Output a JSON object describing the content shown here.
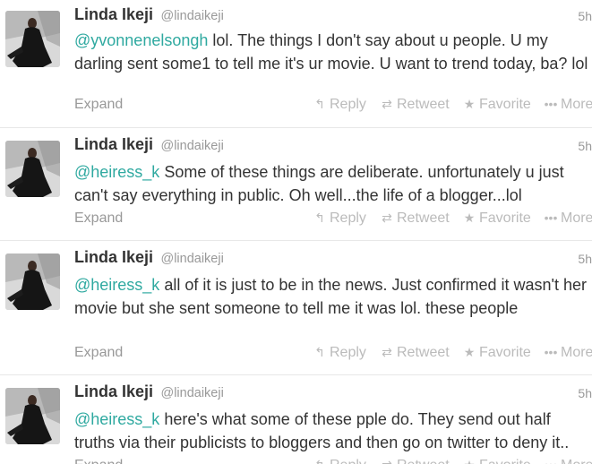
{
  "actions": {
    "expand": "Expand",
    "reply": "Reply",
    "retweet": "Retweet",
    "favorite": "Favorite",
    "more": "More"
  },
  "icons": {
    "reply": "reply-arrow-icon",
    "retweet": "retweet-icon",
    "favorite": "star-icon",
    "more": "ellipsis-icon"
  },
  "colors": {
    "mention": "#2fa9a0",
    "text": "#333333",
    "muted": "#999999"
  },
  "tweets": [
    {
      "fullname": "Linda Ikeji",
      "username": "@lindaikeji",
      "time": "5h",
      "mention": "@yvonnenelsongh",
      "body": " lol. The things I don't say about u people. U my darling sent some1 to tell me it's ur movie. U want to trend today, ba? lol"
    },
    {
      "fullname": "Linda Ikeji",
      "username": "@lindaikeji",
      "time": "5h",
      "mention": "@heiress_k",
      "body": " Some of these things are deliberate. unfortunately u just can't say everything in public. Oh well...the life of a blogger...lol"
    },
    {
      "fullname": "Linda Ikeji",
      "username": "@lindaikeji",
      "time": "5h",
      "mention": "@heiress_k",
      "body": " all of it is just to be in the news. Just confirmed it wasn't her movie but she sent someone to tell me it was lol. these people"
    },
    {
      "fullname": "Linda Ikeji",
      "username": "@lindaikeji",
      "time": "5h",
      "mention": "@heiress_k",
      "body": " here's what some of these pple do. They send out half truths via their publicists to bloggers and then go on twitter to deny it.."
    }
  ]
}
